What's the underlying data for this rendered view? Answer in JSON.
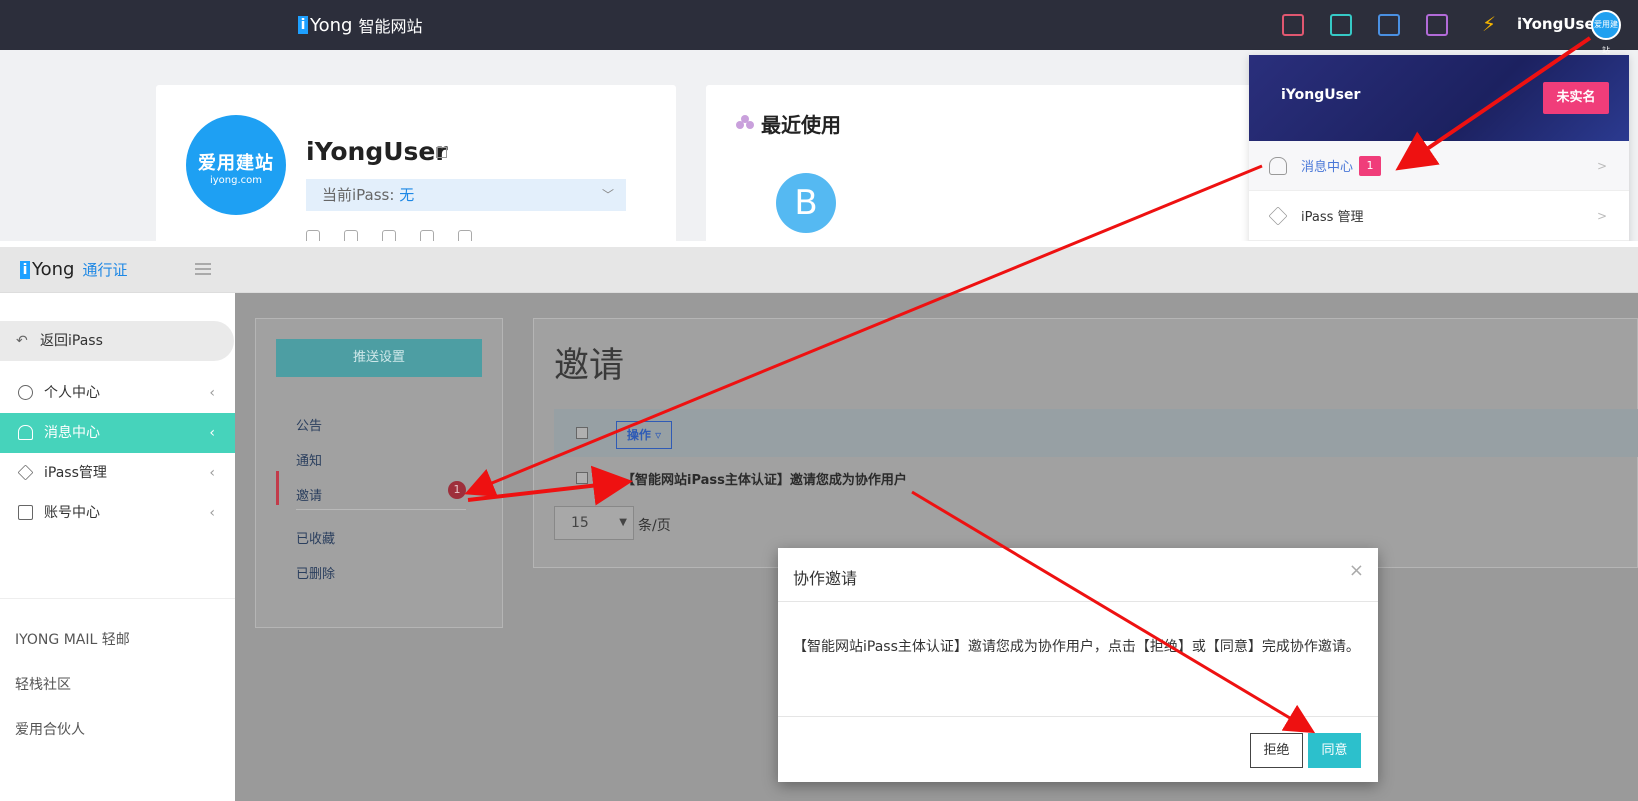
{
  "top": {
    "brand_i": "i",
    "brand_name": "Yong",
    "brand_sub": "智能网站",
    "user_name": "iYongUser",
    "avatar_text": "爱用建站",
    "icons": [
      "home-icon",
      "monitor-icon",
      "building-icon",
      "bag-icon",
      "bolt-icon"
    ],
    "profile": {
      "avatar_line1": "爱用建站",
      "avatar_line2": "iyong.com",
      "name": "iYongUser",
      "ipass_label": "当前iPass: ",
      "ipass_value": "无"
    },
    "recent": {
      "title": "最近使用",
      "item_letter": "B"
    },
    "dropdown": {
      "user_name": "iYongUser",
      "verify_button": "未实名",
      "message_center": "消息中心",
      "message_count": "1",
      "ipass_manage": "iPass 管理",
      "arrow": ">"
    }
  },
  "bottom": {
    "brand_i": "i",
    "brand_name": "Yong",
    "brand_sub": "通行证",
    "sidebar": {
      "back": "返回iPass",
      "items": [
        {
          "label": "个人中心",
          "icon": "user-icon"
        },
        {
          "label": "消息中心",
          "icon": "bell-icon"
        },
        {
          "label": "iPass管理",
          "icon": "layers-icon"
        },
        {
          "label": "账号中心",
          "icon": "wallet-icon"
        }
      ],
      "chevron": "‹",
      "links": [
        "IYONG MAIL 轻邮",
        "轻栈社区",
        "爱用合伙人"
      ]
    },
    "inbox": {
      "push_settings": "推送设置",
      "items": [
        "公告",
        "通知",
        "邀请",
        "已收藏",
        "已删除"
      ],
      "invite_count": "1"
    },
    "invite": {
      "title": "邀请",
      "op_button": "操作",
      "row_text": "【智能网站iPass主体认证】邀请您成为协作用户",
      "page_size": "15",
      "page_unit": "条/页"
    },
    "modal": {
      "title": "协作邀请",
      "close": "×",
      "body": "【智能网站iPass主体认证】邀请您成为协作用户，点击【拒绝】或【同意】完成协作邀请。",
      "reject": "拒绝",
      "agree": "同意"
    }
  },
  "colors": {
    "topbar": "#2c2e3b",
    "accent_teal": "#46d3bb",
    "badge_pink": "#f03d7a",
    "agree_button": "#2cc0cc",
    "arrow_red": "#ee1111"
  }
}
